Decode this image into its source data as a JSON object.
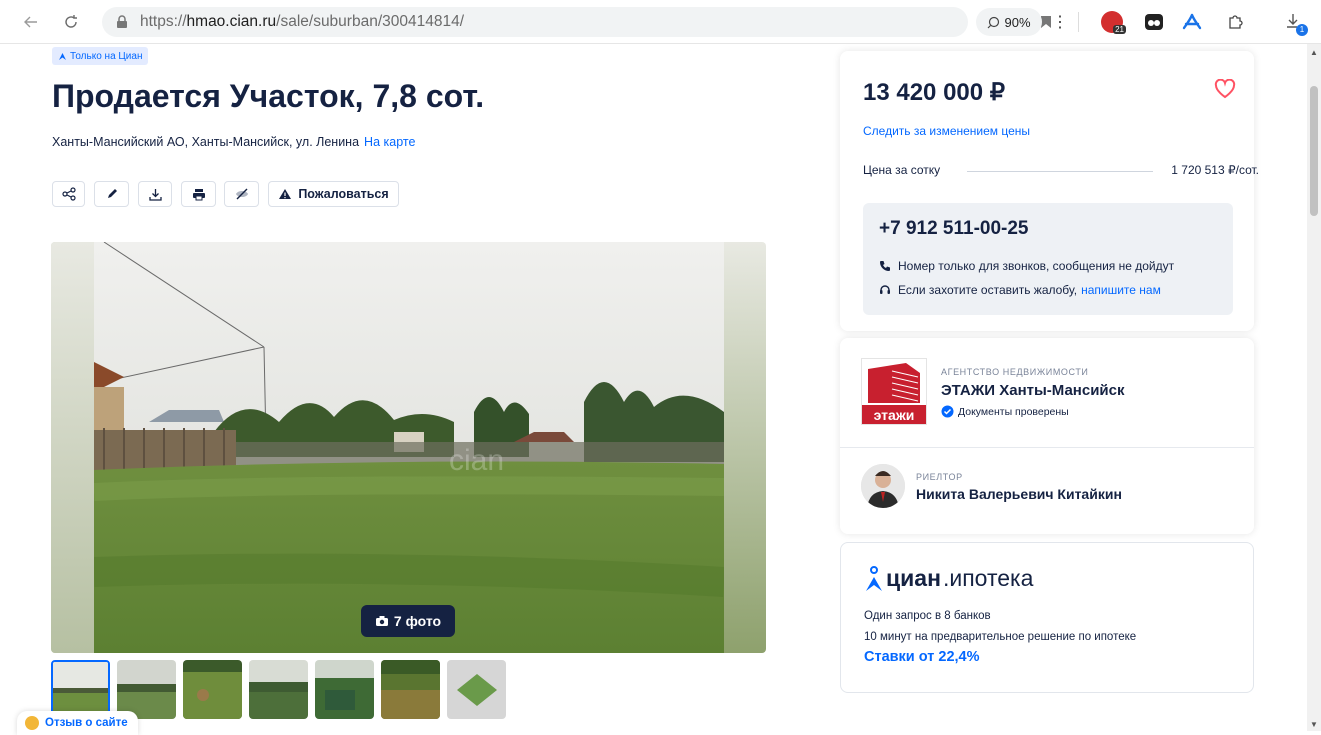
{
  "browser": {
    "url_prefix": "https://",
    "url_domain": "hmao.cian.ru",
    "url_path": "/sale/suburban/300414814/",
    "zoom": "90%",
    "ext_badge": "21",
    "download_badge": "1"
  },
  "listing": {
    "badge": "Только на Циан",
    "title": "Продается Участок, 7,8 сот.",
    "address": "Ханты-Мансийский АО, Ханты-Мансийск, ул. Ленина",
    "map_link": "На карте",
    "complain_label": "Пожаловаться",
    "photo_count": "7 фото",
    "photo_watermark": "cian"
  },
  "price_card": {
    "price": "13 420 000 ₽",
    "watch_label": "Следить за изменением цены",
    "per_unit_label": "Цена за сотку",
    "per_unit_value": "1 720 513 ₽/сот.",
    "phone": "+7 912 511-00-25",
    "note_calls": "Номер только для звонков, сообщения не дойдут",
    "note_complaint": "Если захотите оставить жалобу,",
    "note_link": "напишите нам"
  },
  "agency_card": {
    "agency_caption": "АГЕНТСТВО НЕДВИЖИМОСТИ",
    "agency_name": "ЭТАЖИ Ханты-Мансийск",
    "logo_text": "этажи",
    "verified": "Документы проверены",
    "realtor_caption": "РИЕЛТОР",
    "realtor_name": "Никита Валерьевич Китайкин"
  },
  "mortgage_card": {
    "logo_bold": "циан",
    "logo_light": ".ипотека",
    "line1": "Один запрос в 8 банков",
    "line2": "10 минут на предварительное решение по ипотеке",
    "rates": "Ставки от 22,4%"
  },
  "feedback": {
    "label": "Отзыв о сайте"
  },
  "colors": {
    "accent": "#0468ff",
    "text": "#152242",
    "heart": "#ff5263",
    "logo_red": "#c8202f"
  }
}
